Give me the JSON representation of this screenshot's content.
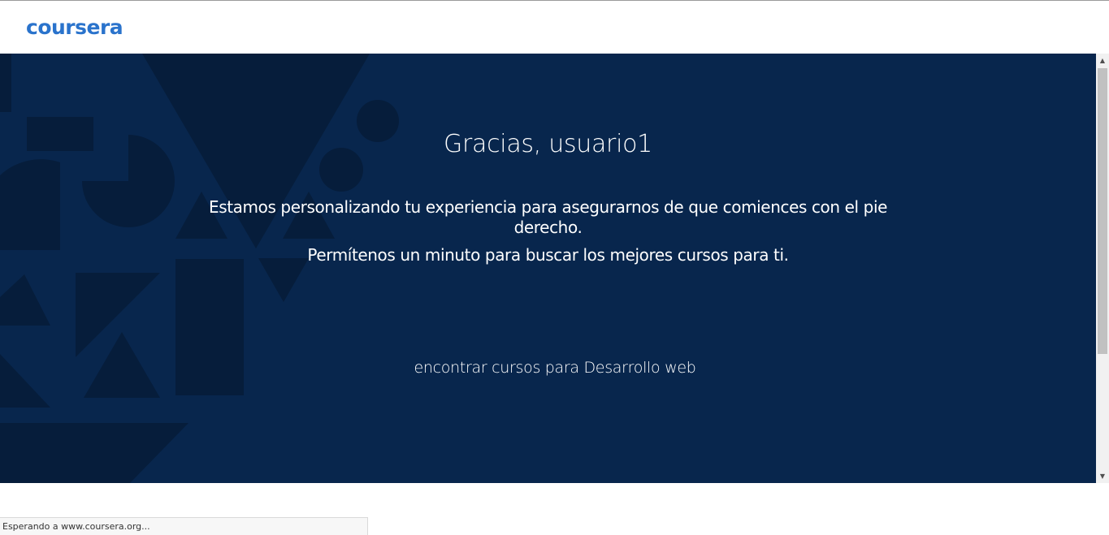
{
  "header": {
    "logo_text": "coursera",
    "logo_color": "#2a73cc"
  },
  "hero": {
    "background_color": "#08264d",
    "shape_color": "#061d3b",
    "title": "Gracias, usuario1",
    "message_line1": "Estamos personalizando tu experiencia para asegurarnos de que comiences con el pie derecho.",
    "message_line2": "Permítenos un minuto para buscar los mejores cursos para ti.",
    "finding_text": "encontrar cursos para Desarrollo web"
  },
  "scrollbar": {
    "up_icon": "scroll-up-arrow",
    "down_icon": "scroll-down-arrow"
  },
  "status_bar": {
    "text": "Esperando a www.coursera.org..."
  }
}
